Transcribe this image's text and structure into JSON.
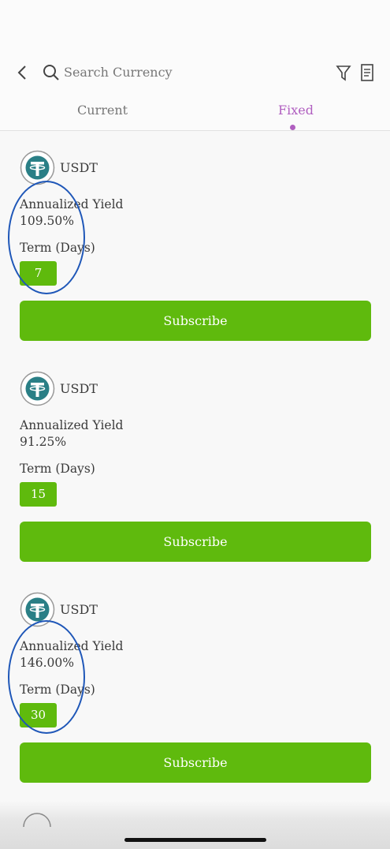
{
  "header": {
    "search_placeholder": "Search Currency"
  },
  "tabs": [
    {
      "label": "Current",
      "active": false
    },
    {
      "label": "Fixed",
      "active": true
    }
  ],
  "colors": {
    "accent": "#b05fc0",
    "button": "#5fba0d",
    "annotation": "#1f57b8",
    "coin": "#2a7f86"
  },
  "cards": [
    {
      "currency": "USDT",
      "yield_label": "Annualized Yield",
      "yield_value": "109.50%",
      "term_label": "Term (Days)",
      "term": "7",
      "button": "Subscribe",
      "annotated": true
    },
    {
      "currency": "USDT",
      "yield_label": "Annualized Yield",
      "yield_value": "91.25%",
      "term_label": "Term (Days)",
      "term": "15",
      "button": "Subscribe",
      "annotated": false
    },
    {
      "currency": "USDT",
      "yield_label": "Annualized Yield",
      "yield_value": "146.00%",
      "term_label": "Term (Days)",
      "term": "30",
      "button": "Subscribe",
      "annotated": true
    }
  ]
}
